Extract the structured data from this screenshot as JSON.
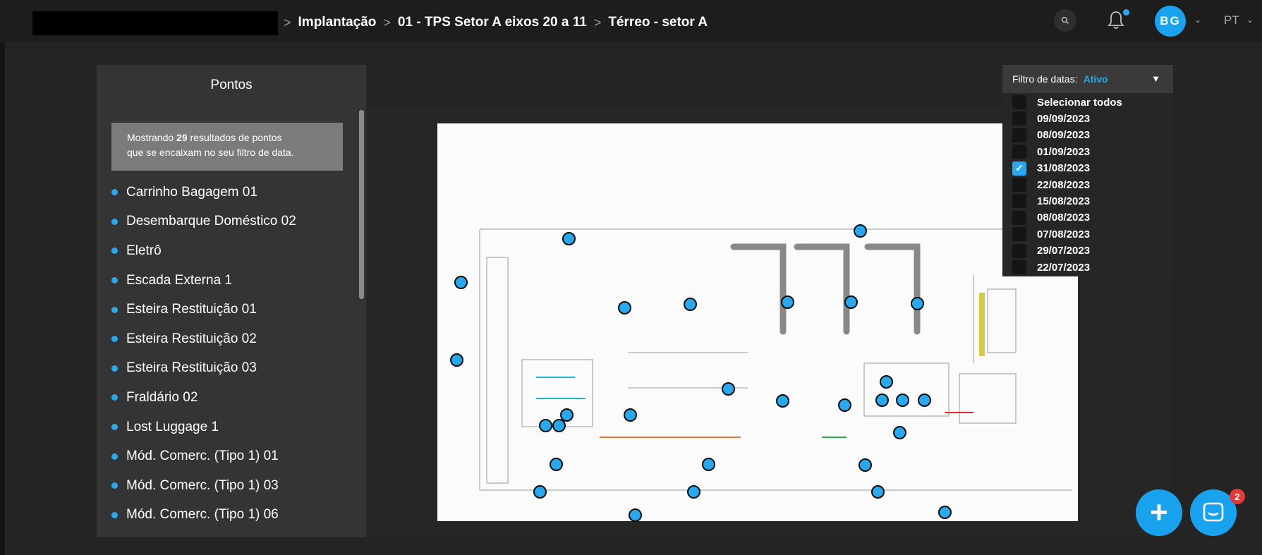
{
  "header": {
    "breadcrumb": [
      "Implantação",
      "01 - TPS Setor A eixos 20 a 11",
      "Térreo - setor A"
    ],
    "breadcrumb_separator": ">",
    "avatar_initials": "BG",
    "language": "PT"
  },
  "sidebar": {
    "title": "Pontos",
    "info": {
      "prefix": "Mostrando",
      "count": "29",
      "text_line1": "resultados de pontos",
      "text_line2": "que se encaixam no seu filtro de data."
    },
    "items": [
      "Carrinho Bagagem 01",
      "Desembarque Doméstico 02",
      "Eletrô",
      "Escada Externa 1",
      "Esteira Restituição 01",
      "Esteira Restituição 02",
      "Esteira Restituição 03",
      "Fraldário 02",
      "Lost Luggage 1",
      "Mód. Comerc. (Tipo 1) 01",
      "Mód. Comerc. (Tipo 1) 03",
      "Mód. Comerc. (Tipo 1) 06"
    ]
  },
  "date_filter": {
    "label": "Filtro de datas:",
    "status": "Ativo",
    "select_all": "Selecionar todos",
    "options": [
      {
        "date": "09/09/2023",
        "checked": false
      },
      {
        "date": "08/09/2023",
        "checked": false
      },
      {
        "date": "01/09/2023",
        "checked": false
      },
      {
        "date": "31/08/2023",
        "checked": true
      },
      {
        "date": "22/08/2023",
        "checked": false
      },
      {
        "date": "15/08/2023",
        "checked": false
      },
      {
        "date": "08/08/2023",
        "checked": false
      },
      {
        "date": "07/08/2023",
        "checked": false
      },
      {
        "date": "29/07/2023",
        "checked": false
      },
      {
        "date": "22/07/2023",
        "checked": false
      }
    ]
  },
  "chat": {
    "badge": "2"
  },
  "colors": {
    "accent": "#2aa8ee",
    "background": "#242424",
    "panel": "#343434",
    "badge": "#e43a3a"
  },
  "icons": [
    "search-icon",
    "bell-icon",
    "chevron-down-icon",
    "plus-icon",
    "chat-icon",
    "check-icon"
  ]
}
